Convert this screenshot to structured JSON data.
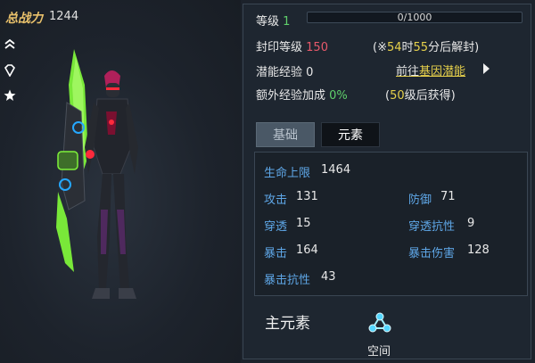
{
  "header": {
    "power_label": "总战力",
    "power_value": "1244"
  },
  "sidebar": {
    "icons": [
      "double-chevron-up-icon",
      "diamond-icon",
      "star-icon"
    ]
  },
  "level": {
    "label": "等级",
    "value": "1",
    "exp_text": "0/1000",
    "progress": 0
  },
  "seal": {
    "label": "封印等级",
    "value": "150",
    "note_prefix": "(※",
    "hours": "54",
    "hours_unit": "时",
    "minutes": "55",
    "minutes_suffix": "分后解封)"
  },
  "potential": {
    "label": "潜能经验",
    "value": "0",
    "link_prefix": "前往",
    "link_target": "基因潜能"
  },
  "bonus": {
    "label": "额外经验加成",
    "value": "0%",
    "note_prefix": "(",
    "note_level": "50",
    "note_suffix": "级后获得)"
  },
  "tabs": {
    "basic": "基础",
    "element": "元素"
  },
  "stats": {
    "hp": {
      "label": "生命上限",
      "value": "1464"
    },
    "attack": {
      "label": "攻击",
      "value": "131"
    },
    "defense": {
      "label": "防御",
      "value": "71"
    },
    "pierce": {
      "label": "穿透",
      "value": "15"
    },
    "pierce_resist": {
      "label": "穿透抗性",
      "value": "9"
    },
    "crit": {
      "label": "暴击",
      "value": "164"
    },
    "crit_damage": {
      "label": "暴击伤害",
      "value": "128"
    },
    "crit_resist": {
      "label": "暴击抗性",
      "value": "43"
    }
  },
  "element": {
    "title": "主元素",
    "name": "空间",
    "icon": "space-element-icon"
  },
  "colors": {
    "accent_gold": "#e9c16b",
    "stat_label_blue": "#5ea6e6",
    "level_green": "#5fd06b",
    "seal_red": "#e7596b",
    "note_yellow": "#e6d04b",
    "armor_green": "#7ef23a",
    "visor_red": "#ff2a3c"
  }
}
